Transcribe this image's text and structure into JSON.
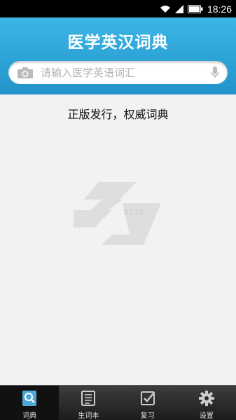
{
  "status_bar": {
    "time": "18:26",
    "battery_level": 1.0
  },
  "header": {
    "title": "医学英汉词典",
    "background": "#2ba3d6"
  },
  "search": {
    "placeholder": "请输入医学英语词汇",
    "value": ""
  },
  "main": {
    "slogan": "正版发行，权威词典",
    "watermark_text": "SSTP"
  },
  "tabs": [
    {
      "label": "词典",
      "icon": "dictionary-search-icon",
      "active": true
    },
    {
      "label": "生词本",
      "icon": "notebook-icon",
      "active": false
    },
    {
      "label": "复习",
      "icon": "review-check-icon",
      "active": false
    },
    {
      "label": "设置",
      "icon": "gear-icon",
      "active": false
    }
  ]
}
